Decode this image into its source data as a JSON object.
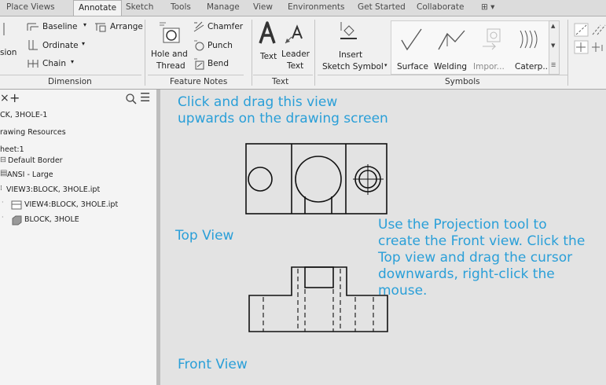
{
  "tabs": [
    "Place Views",
    "Annotate",
    "Sketch",
    "Tools",
    "Manage",
    "View",
    "Environments",
    "Get Started",
    "Collaborate",
    "⊞ ▾"
  ],
  "ribbon": {
    "dimension": {
      "baseline": "Baseline",
      "arrange": "Arrange",
      "ordinate": "Ordinate",
      "chain": "Chain",
      "partial": "sion",
      "group": "Dimension"
    },
    "feature_notes": {
      "hole_and": "Hole and",
      "thread": "Thread",
      "chamfer": "Chamfer",
      "punch": "Punch",
      "bend": "Bend",
      "group": "Feature Notes"
    },
    "text": {
      "text": "Text",
      "leader": "Leader",
      "leader_text": "Text",
      "group": "Text"
    },
    "symbols": {
      "insert": "Insert",
      "sketch_symbol": "Sketch Symbol",
      "surface": "Surface",
      "welding": "Welding",
      "import": "Impor...",
      "caterpillar": "Caterp...",
      "group": "Symbols"
    }
  },
  "browser": {
    "plus": "+",
    "items": [
      "CK, 3HOLE-1",
      "rawing Resources",
      "heet:1",
      "Default Border",
      "ANSI - Large",
      "VIEW3:BLOCK, 3HOLE.ipt",
      "VIEW4:BLOCK, 3HOLE.ipt",
      "BLOCK, 3HOLE"
    ]
  },
  "annotations": {
    "drag_note": [
      "Click and drag this view",
      "upwards on the drawing screen"
    ],
    "top_view": "Top View",
    "projection_note": [
      "Use the Projection tool to",
      "create the Front view. Click the",
      "Top view and drag the cursor",
      "downwards, right-click the",
      "mouse."
    ],
    "front_view": "Front View"
  },
  "colors": {
    "annotation": "#2a9fd8",
    "drawing_line": "#111111"
  }
}
